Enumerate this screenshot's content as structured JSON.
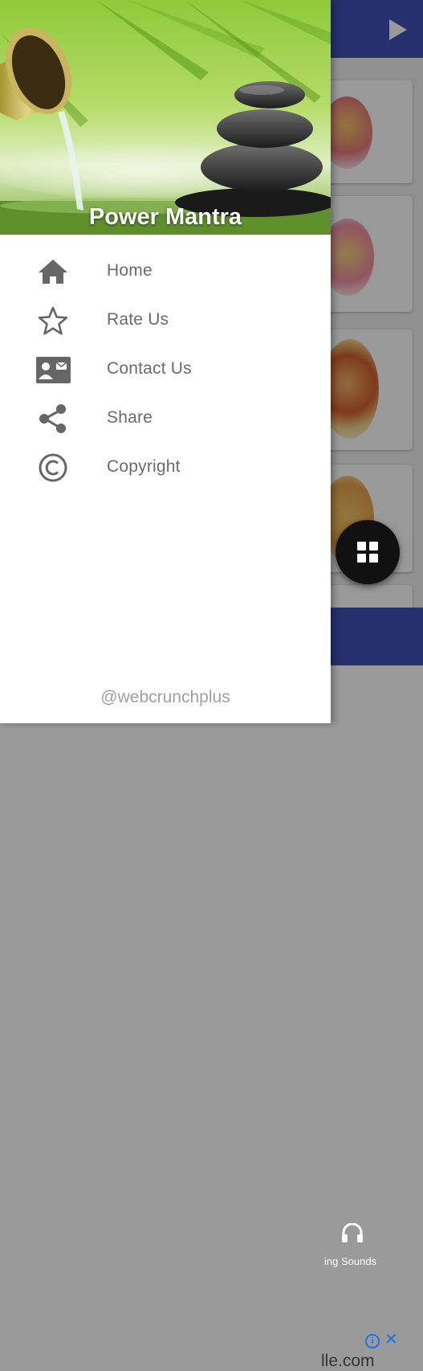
{
  "app": {
    "toolbar_color": "#3f51b5",
    "background_cards": [
      {
        "name": "ganesha-card"
      },
      {
        "name": "lakshmi-card"
      },
      {
        "name": "buddha-card"
      },
      {
        "name": "ganesha-gold-card"
      }
    ],
    "bottom_nav": {
      "label": "ing Sounds",
      "icon": "headphones-icon"
    },
    "ad": {
      "text": "lle.com",
      "info_label": "i",
      "close_label": "✕"
    },
    "fab": {
      "icon": "grid-icon"
    }
  },
  "drawer": {
    "title": "Power Mantra",
    "header_image": "zen-stones-bamboo-waterfall",
    "items": [
      {
        "label": "Home",
        "icon": "home-icon"
      },
      {
        "label": "Rate Us",
        "icon": "star-outline-icon"
      },
      {
        "label": "Contact Us",
        "icon": "contact-card-icon"
      },
      {
        "label": "Share",
        "icon": "share-icon"
      },
      {
        "label": "Copyright",
        "icon": "copyright-icon"
      }
    ],
    "footer": "@webcrunchplus",
    "colors": {
      "text": "#6a6a6a",
      "icon": "#666666",
      "footer": "#a0a0a0"
    }
  }
}
